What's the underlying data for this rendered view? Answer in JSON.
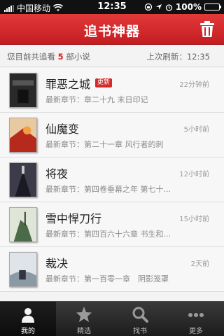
{
  "status_bar": {
    "carrier": "中国移动",
    "time": "12:35",
    "battery": "100%",
    "battery_level": 1.0
  },
  "nav": {
    "title": "追书神器",
    "trash_icon": "trash-icon"
  },
  "info": {
    "prefix": "您目前共追看",
    "count": "5",
    "suffix": "部小说",
    "refresh": "上次刷新：12:35"
  },
  "books": [
    {
      "title": "罪恶之城",
      "badge": "更新",
      "time": "22分钟前",
      "chapter": "最新章节：章二十九 末日印记",
      "cover_color": "#2a2a2a"
    },
    {
      "title": "仙魔变",
      "badge": "",
      "time": "5小时前",
      "chapter": "最新章节：第二十一章 风行者的刺",
      "cover_color": "#b52a1c"
    },
    {
      "title": "将夜",
      "badge": "",
      "time": "12小时前",
      "chapter": "最新章节：第四卷垂幕之年 第七十...",
      "cover_color": "#3b3b4a"
    },
    {
      "title": "雪中悍刀行",
      "badge": "",
      "time": "15小时前",
      "chapter": "最新章节：第四百六十六章 书生和...",
      "cover_color": "#4a6a48"
    },
    {
      "title": "裁决",
      "badge": "",
      "time": "2天前",
      "chapter": "最新章节：第一百零一章　阴影笼罩",
      "cover_color": "#8a9aa4"
    }
  ],
  "tabs": [
    {
      "label": "我的",
      "icon": "person-icon",
      "active": true
    },
    {
      "label": "精选",
      "icon": "star-icon",
      "active": false
    },
    {
      "label": "找书",
      "icon": "search-icon",
      "active": false
    },
    {
      "label": "更多",
      "icon": "more-icon",
      "active": false
    }
  ]
}
